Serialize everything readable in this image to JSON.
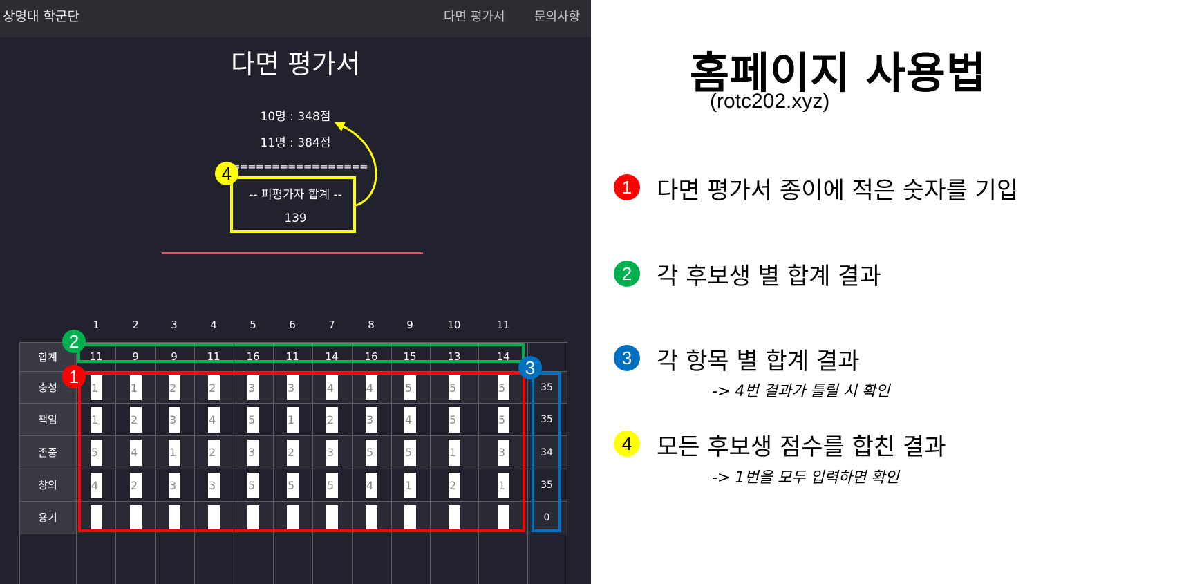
{
  "navbar": {
    "brand": "상명대 학군단",
    "links": [
      "다면 평가서",
      "문의사항"
    ]
  },
  "page_title": "다면 평가서",
  "scores": [
    "10명 : 348점",
    "11명 : 384점"
  ],
  "divider": "==================",
  "total_label": "-- 피평가자 합계 --",
  "total_value": "139",
  "columns": [
    "1",
    "2",
    "3",
    "4",
    "5",
    "6",
    "7",
    "8",
    "9",
    "10",
    "11"
  ],
  "rows": [
    {
      "label": "합계",
      "values": [
        "11",
        "9",
        "9",
        "11",
        "16",
        "11",
        "14",
        "16",
        "15",
        "13",
        "14"
      ],
      "total": ""
    },
    {
      "label": "충성",
      "values": [
        "1",
        "1",
        "2",
        "2",
        "3",
        "3",
        "4",
        "4",
        "5",
        "5",
        "5"
      ],
      "total": "35"
    },
    {
      "label": "책임",
      "values": [
        "1",
        "2",
        "3",
        "4",
        "5",
        "1",
        "2",
        "3",
        "4",
        "5",
        "5"
      ],
      "total": "35"
    },
    {
      "label": "존중",
      "values": [
        "5",
        "4",
        "1",
        "2",
        "3",
        "2",
        "3",
        "5",
        "5",
        "1",
        "3"
      ],
      "total": "34"
    },
    {
      "label": "창의",
      "values": [
        "4",
        "2",
        "3",
        "3",
        "5",
        "5",
        "5",
        "4",
        "1",
        "2",
        "1"
      ],
      "total": "35"
    },
    {
      "label": "용기",
      "values": [
        "",
        "",
        "",
        "",
        "",
        "",
        "",
        "",
        "",
        "",
        ""
      ],
      "total": "0"
    }
  ],
  "annotations": {
    "badges": [
      "1",
      "2",
      "3",
      "4"
    ],
    "colors": {
      "red": "#ff0000",
      "green": "#00b050",
      "blue": "#0070c0",
      "yellow": "#ffff00"
    }
  },
  "guide": {
    "title": "홈페이지 사용법",
    "url": "(rotc202.xyz)",
    "steps": [
      {
        "num": "1",
        "text": "다면 평가서 종이에 적은 숫자를 기입",
        "sub": ""
      },
      {
        "num": "2",
        "text": "각 후보생 별 합계 결과",
        "sub": ""
      },
      {
        "num": "3",
        "text": "각 항목 별 합계 결과",
        "sub": "-> 4번 결과가 틀릴 시 확인"
      },
      {
        "num": "4",
        "text": "모든 후보생 점수를 합친 결과",
        "sub": "-> 1번을 모두 입력하면 확인"
      }
    ]
  }
}
